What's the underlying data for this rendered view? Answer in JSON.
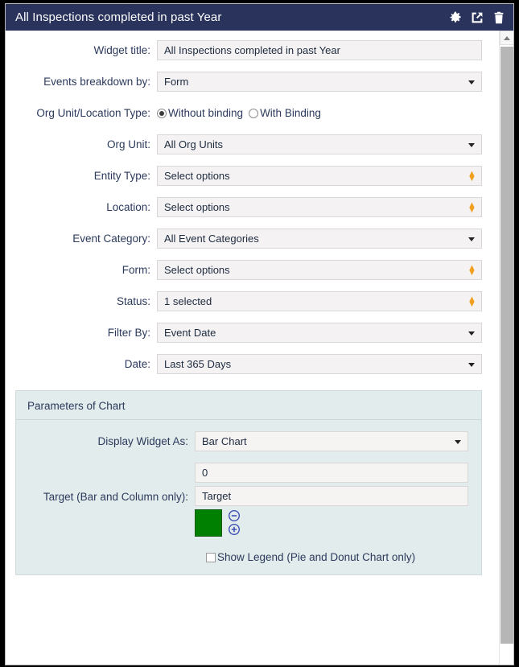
{
  "titlebar": {
    "title": "All Inspections completed in past Year",
    "icons": [
      {
        "name": "gear-icon",
        "label": "Settings"
      },
      {
        "name": "expand-icon",
        "label": "Expand"
      },
      {
        "name": "trash-icon",
        "label": "Delete"
      }
    ]
  },
  "form": {
    "widget_title": {
      "label": "Widget title:",
      "value": "All Inspections completed in past Year"
    },
    "events_breakdown": {
      "label": "Events breakdown by:",
      "value": "Form"
    },
    "org_unit_location_type": {
      "label": "Org Unit/Location Type:",
      "options": [
        {
          "label": "Without binding",
          "selected": true
        },
        {
          "label": "With Binding",
          "selected": false
        }
      ]
    },
    "org_unit": {
      "label": "Org Unit:",
      "value": "All Org Units"
    },
    "entity_type": {
      "label": "Entity Type:",
      "value": "Select options"
    },
    "location": {
      "label": "Location:",
      "value": "Select options"
    },
    "event_category": {
      "label": "Event Category:",
      "value": "All Event Categories"
    },
    "form_field": {
      "label": "Form:",
      "value": "Select options"
    },
    "status": {
      "label": "Status:",
      "value": "1 selected"
    },
    "filter_by": {
      "label": "Filter By:",
      "value": "Event Date"
    },
    "date": {
      "label": "Date:",
      "value": "Last 365 Days"
    }
  },
  "panel": {
    "title": "Parameters of Chart",
    "display_widget_as": {
      "label": "Display Widget As:",
      "value": "Bar Chart"
    },
    "target": {
      "label": "Target (Bar and Column only):",
      "value": "0",
      "name_value": "Target",
      "color": "#008000",
      "remove_icon": "minus-circle-icon",
      "add_icon": "plus-circle-icon"
    },
    "show_legend": {
      "label": "Show Legend (Pie and Donut Chart only)",
      "checked": false
    }
  },
  "colors": {
    "titlebar": "#29335c",
    "panel_bg": "#e3ecec",
    "accent_orange": "#f0a01e",
    "target_green": "#008000"
  }
}
